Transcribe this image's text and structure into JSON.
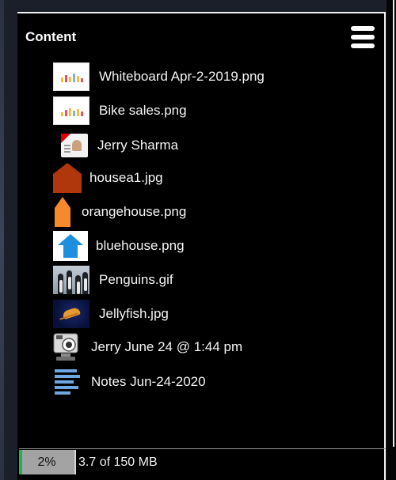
{
  "panel": {
    "title": "Content",
    "menu_icon": "hamburger-menu-icon"
  },
  "items": [
    {
      "label": "Whiteboard Apr-2-2019.png",
      "icon": "whiteboard-thumbnail"
    },
    {
      "label": "Bike sales.png",
      "icon": "whiteboard-thumbnail"
    },
    {
      "label": "Jerry Sharma",
      "icon": "contact-card-icon"
    },
    {
      "label": "housea1.jpg",
      "icon": "red-house-thumbnail"
    },
    {
      "label": "orangehouse.png",
      "icon": "orange-house-thumbnail"
    },
    {
      "label": "bluehouse.png",
      "icon": "blue-house-thumbnail"
    },
    {
      "label": "Penguins.gif",
      "icon": "penguins-thumbnail"
    },
    {
      "label": "Jellyfish.jpg",
      "icon": "jellyfish-thumbnail"
    },
    {
      "label": "Jerry June 24 @ 1:44 pm",
      "icon": "webcam-icon"
    },
    {
      "label": "Notes Jun-24-2020",
      "icon": "notes-icon"
    }
  ],
  "storage": {
    "percent_label": "2%",
    "percent_value": 0.02,
    "usage_label": "3.7 of 150 MB"
  },
  "colors": {
    "house_red": "#b0360c",
    "house_orange": "#f58a2c",
    "house_blue": "#1e8fe0",
    "storage_fill": "#22b14c"
  }
}
